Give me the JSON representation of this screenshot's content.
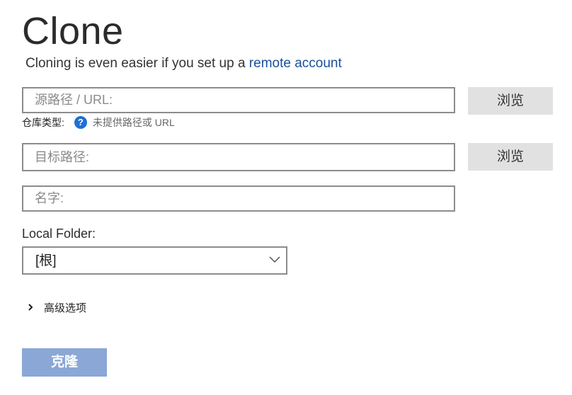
{
  "header": {
    "title": "Clone",
    "subtitle_prefix": "Cloning is even easier if you set up a ",
    "subtitle_link": "remote account"
  },
  "source": {
    "placeholder": "源路径 / URL:",
    "value": "",
    "browse_label": "浏览"
  },
  "repo_type": {
    "label": "仓库类型:",
    "icon": "question-circle-icon",
    "status": "未提供路径或 URL"
  },
  "target": {
    "placeholder": "目标路径:",
    "value": "",
    "browse_label": "浏览"
  },
  "name": {
    "placeholder": "名字:",
    "value": ""
  },
  "local_folder": {
    "label": "Local Folder:",
    "selected": "[根]"
  },
  "advanced": {
    "label": "高级选项",
    "icon": "chevron-right-icon"
  },
  "actions": {
    "clone_label": "克隆"
  },
  "colors": {
    "link": "#1a4f9c",
    "help_icon": "#1f6fd6",
    "clone_button_disabled": "#8aa7d6",
    "browse_button": "#e1e1e1"
  }
}
